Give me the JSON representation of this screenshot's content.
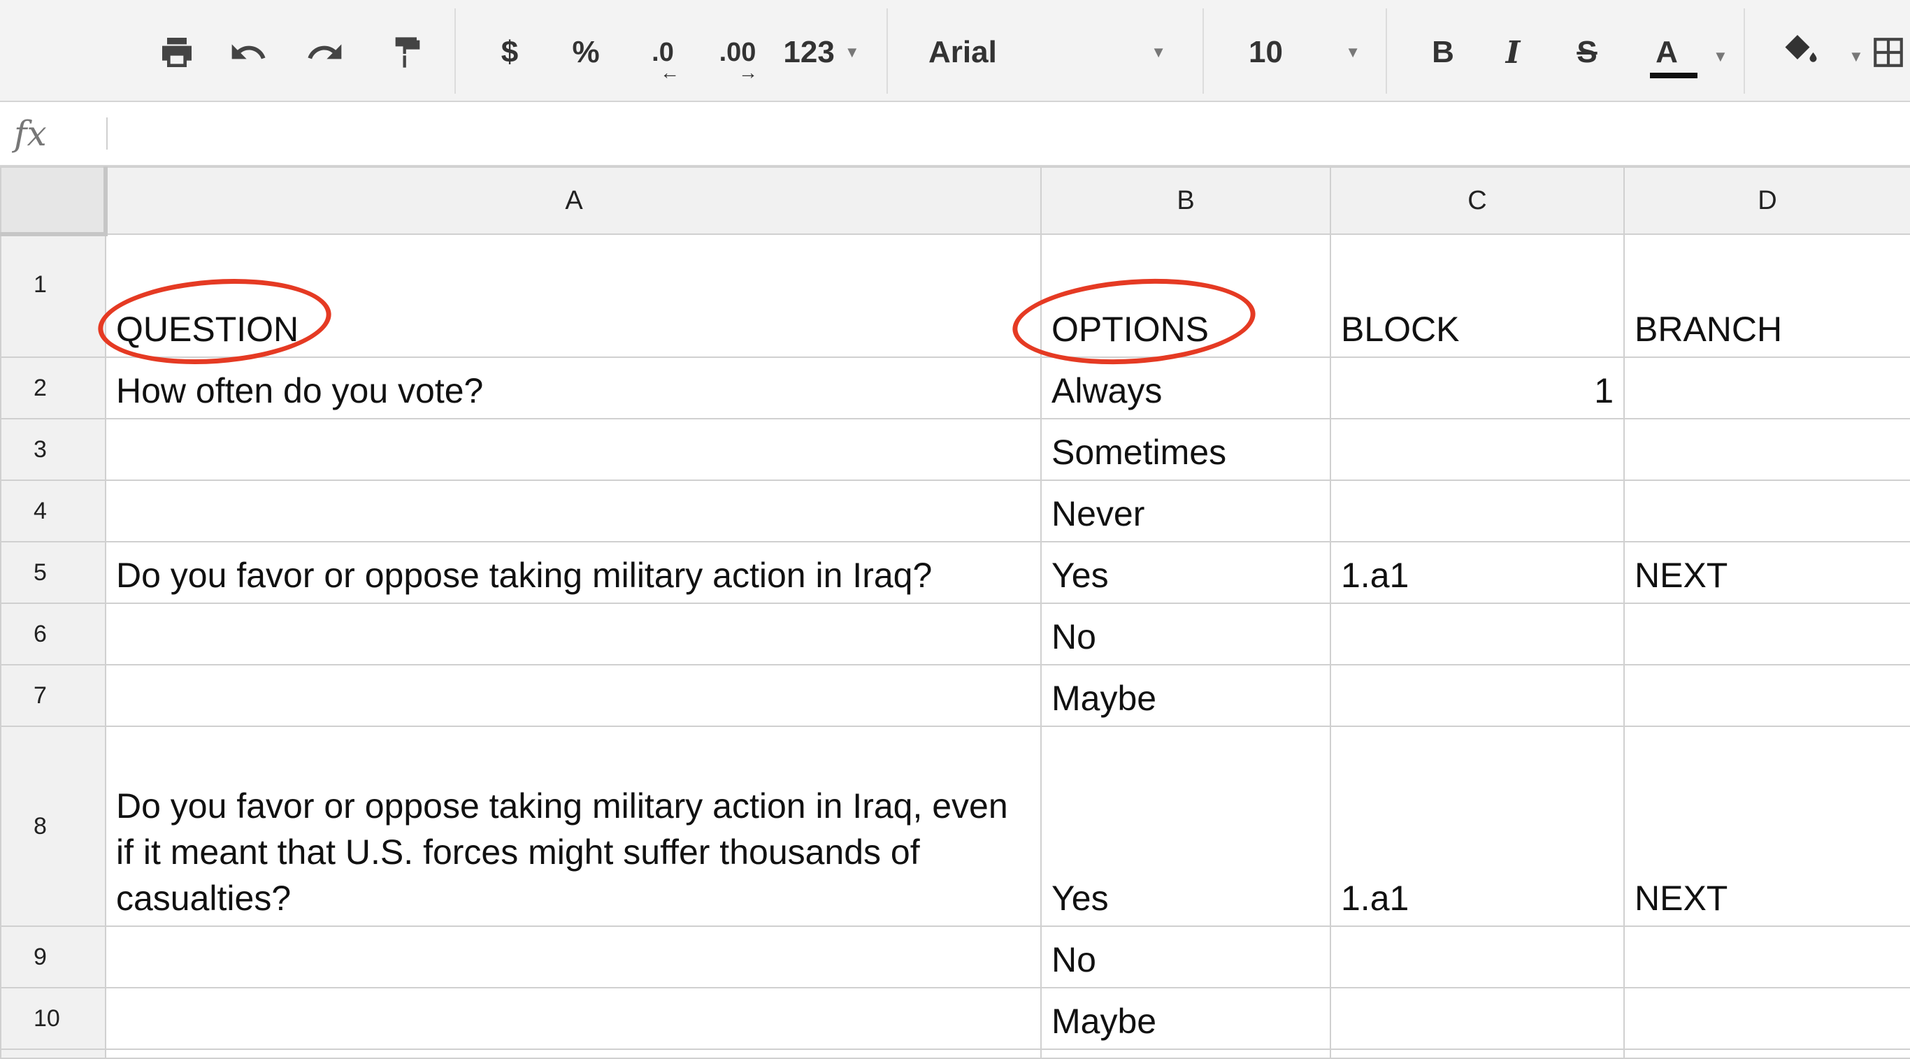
{
  "toolbar": {
    "currency_label": "$",
    "percent_label": "%",
    "decimal_decrease_label": ".0",
    "decimal_increase_label": ".00",
    "more_formats_label": "123",
    "font_family_value": "Arial",
    "font_size_value": "10",
    "bold_label": "B",
    "italic_label": "I",
    "strike_label": "S",
    "text_color_label": "A",
    "text_color_bar": "#111111"
  },
  "formula_bar": {
    "fx_label": "fx",
    "value": ""
  },
  "columns": [
    "A",
    "B",
    "C",
    "D"
  ],
  "rows": [
    {
      "n": "1",
      "a": "QUESTION",
      "b": "OPTIONS",
      "c": "BLOCK",
      "d": "BRANCH"
    },
    {
      "n": "2",
      "a": "How often do you vote?",
      "b": "Always",
      "c": "1",
      "d": ""
    },
    {
      "n": "3",
      "a": "",
      "b": "Sometimes",
      "c": "",
      "d": ""
    },
    {
      "n": "4",
      "a": "",
      "b": "Never",
      "c": "",
      "d": ""
    },
    {
      "n": "5",
      "a": "Do you favor or oppose taking military action in Iraq?",
      "b": "Yes",
      "c": "1.a1",
      "d": "NEXT"
    },
    {
      "n": "6",
      "a": "",
      "b": "No",
      "c": "",
      "d": ""
    },
    {
      "n": "7",
      "a": "",
      "b": "Maybe",
      "c": "",
      "d": ""
    },
    {
      "n": "8",
      "a": "Do you favor or oppose taking military action in Iraq, even if it meant that U.S. forces might suffer thousands of casualties?",
      "b": "Yes",
      "c": "1.a1",
      "d": "NEXT"
    },
    {
      "n": "9",
      "a": "",
      "b": "No",
      "c": "",
      "d": ""
    },
    {
      "n": "10",
      "a": "",
      "b": "Maybe",
      "c": "",
      "d": ""
    }
  ],
  "colors": {
    "annotation": "#e53a23",
    "header_bg": "#f1f1f1",
    "gridline": "#d0d0d0"
  }
}
